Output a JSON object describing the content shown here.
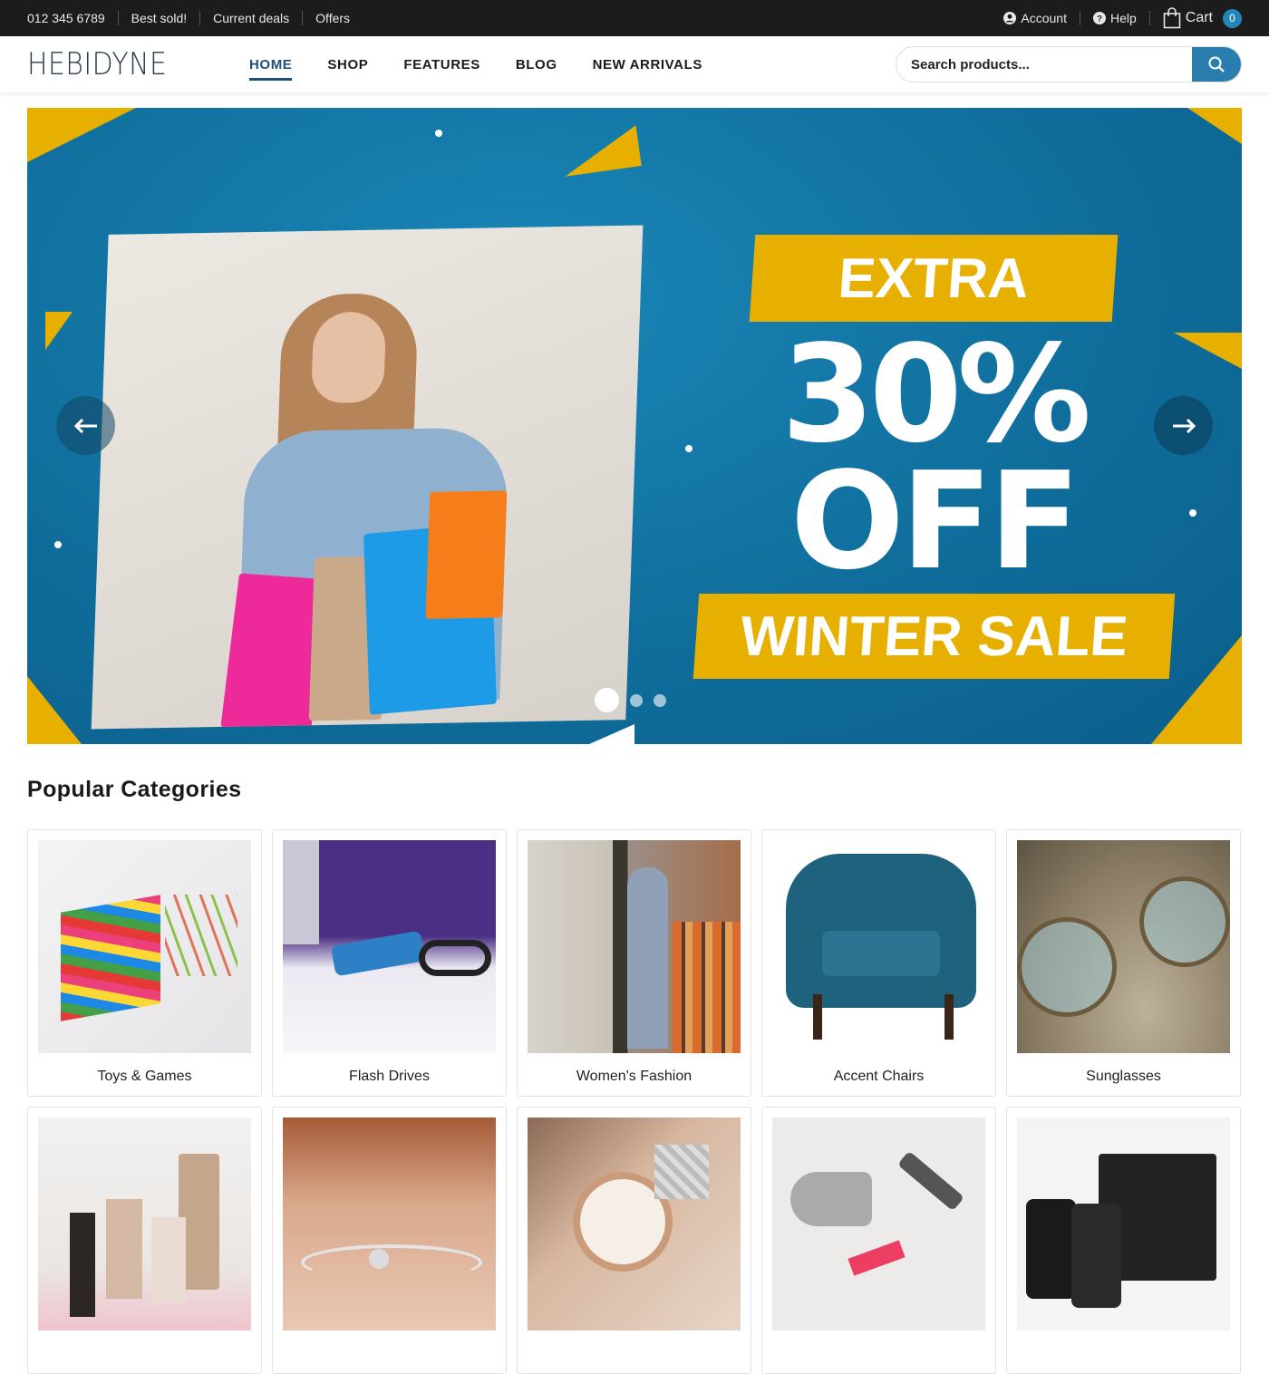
{
  "topbar": {
    "phone": "012 345 6789",
    "links": [
      "Best sold!",
      "Current deals",
      "Offers"
    ],
    "account": "Account",
    "help": "Help",
    "cart": "Cart",
    "cart_count": "0"
  },
  "header": {
    "logo": "HEBIDYNE",
    "nav": [
      "HOME",
      "SHOP",
      "FEATURES",
      "BLOG",
      "NEW ARRIVALS"
    ],
    "active_nav": "HOME",
    "search_placeholder": "Search products..."
  },
  "hero": {
    "line1": "EXTRA",
    "line2": "30%",
    "line3": "OFF",
    "line4": "WINTER SALE",
    "slides": 3,
    "active_slide": 1,
    "colors": {
      "bg": "#0f6c9a",
      "accent": "#e7b000"
    }
  },
  "section_title": "Popular Categories",
  "categories": [
    {
      "name": "Toys & Games"
    },
    {
      "name": "Flash Drives"
    },
    {
      "name": "Women's Fashion"
    },
    {
      "name": "Accent Chairs"
    },
    {
      "name": "Sunglasses"
    },
    {
      "name": ""
    },
    {
      "name": ""
    },
    {
      "name": ""
    },
    {
      "name": ""
    },
    {
      "name": ""
    }
  ]
}
